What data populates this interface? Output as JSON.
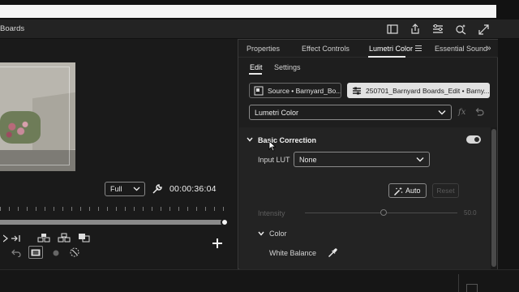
{
  "window": {
    "sequence_title": "Boards"
  },
  "titlebar_icons": [
    "panel-icon",
    "share-icon",
    "menu-list-icon",
    "search-sparkle-icon",
    "expand-icon"
  ],
  "monitor": {
    "fit_value": "Full",
    "timecode": "00:00:36:04",
    "playhead_fraction": 0.97
  },
  "panel": {
    "tabs": [
      {
        "label": "Properties"
      },
      {
        "label": "Effect Controls"
      },
      {
        "label": "Lumetri Color",
        "active": true
      },
      {
        "label": "Essential Sound"
      }
    ],
    "subtabs": [
      {
        "label": "Edit",
        "active": true
      },
      {
        "label": "Settings"
      }
    ],
    "source_clip": "Source • Barnyard_Bo...",
    "target_clip": "250701_Barnyard Boards_Edit • Barny...",
    "effect_select": "Lumetri Color",
    "basic_correction": {
      "title": "Basic Correction",
      "enabled": true,
      "input_lut_label": "Input LUT",
      "input_lut_value": "None",
      "auto_label": "Auto",
      "reset_label": "Reset",
      "intensity_label": "Intensity",
      "intensity_value": "50.0",
      "intensity_fraction": 0.5,
      "color_section": "Color",
      "white_balance_label": "White Balance"
    }
  },
  "colors": {
    "background": "#1b1b1b",
    "panel": "#1e1e1e",
    "selected_clip": "#e2e2e2",
    "text": "#d6d6d6"
  }
}
